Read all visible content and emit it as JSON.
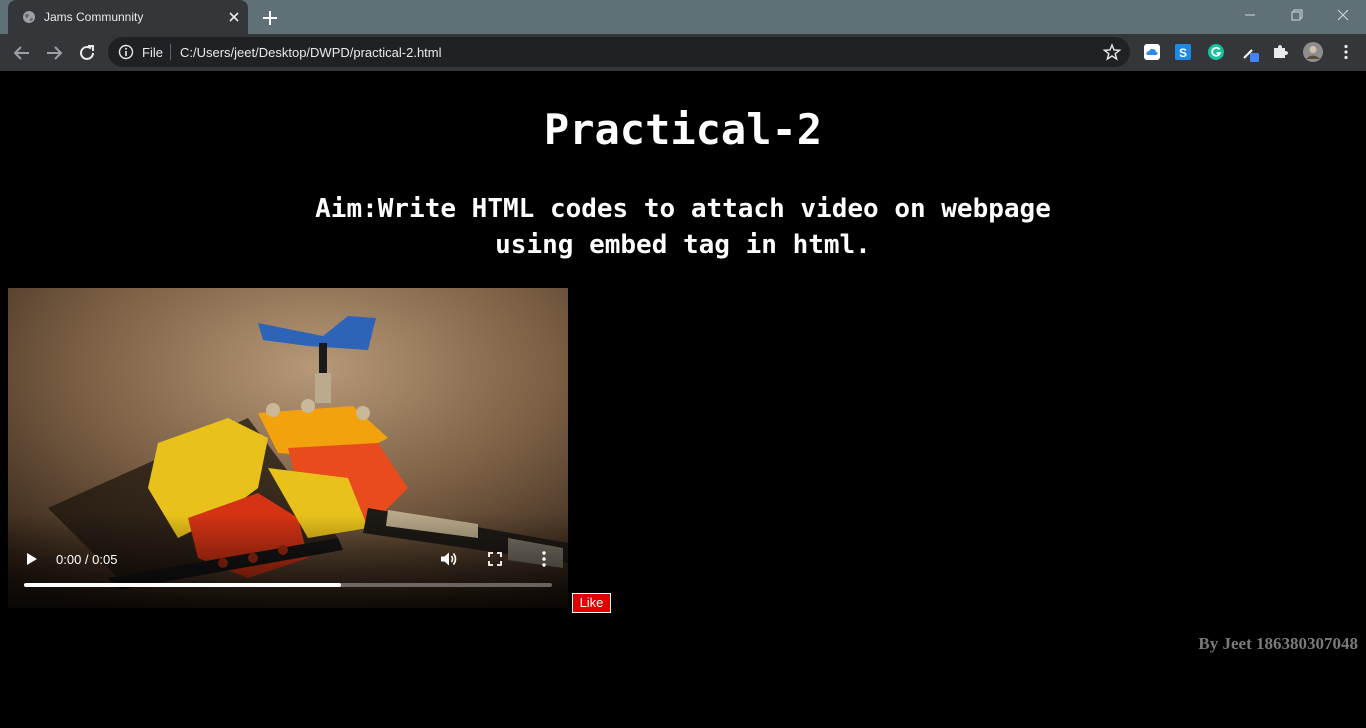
{
  "browser": {
    "tab": {
      "title": "Jams Communnity"
    },
    "omnibox": {
      "scheme": "File",
      "url": "C:/Users/jeet/Desktop/DWPD/practical-2.html"
    },
    "extensions": [
      "cloud-icon",
      "skype-icon",
      "grammarly-icon",
      "eyedropper-icon",
      "puzzle-icon"
    ],
    "colors": {
      "tabstrip": "#5f7176",
      "toolbar": "#35363a",
      "omnibox": "#202124"
    }
  },
  "page": {
    "title": "Practical-2",
    "aim": "Aim:Write HTML codes to attach video on webpage using embed tag in html.",
    "video": {
      "time": "0:00 / 0:05",
      "progress": 0.6
    },
    "like_label": "Like",
    "author": "By Jeet 186380307048",
    "colors": {
      "background": "#000000",
      "like": "#e00000",
      "author": "#7a7a7a"
    }
  }
}
